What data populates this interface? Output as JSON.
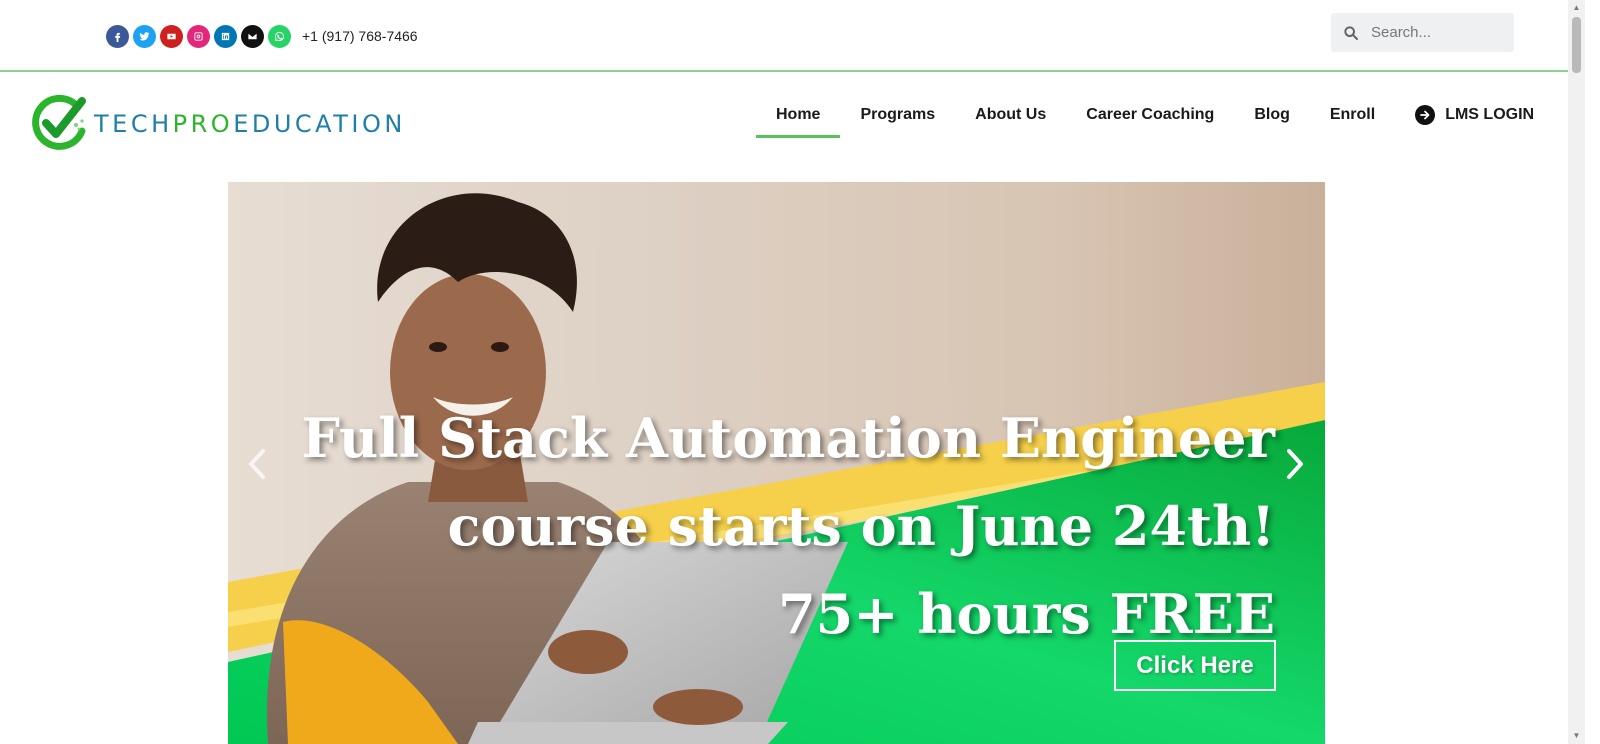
{
  "topbar": {
    "phone": "+1 (917) 768-7466",
    "socials": [
      {
        "icon": "facebook-icon",
        "color": "#3b5998"
      },
      {
        "icon": "twitter-icon",
        "color": "#1da1f2"
      },
      {
        "icon": "youtube-icon",
        "color": "#cd201f"
      },
      {
        "icon": "instagram-icon",
        "color": "#e4267a"
      },
      {
        "icon": "linkedin-icon",
        "color": "#0077b5"
      },
      {
        "icon": "envelope-icon",
        "color": "#111111"
      },
      {
        "icon": "whatsapp-icon",
        "color": "#25d366"
      }
    ],
    "search_placeholder": "Search..."
  },
  "logo": {
    "part1": "TECH",
    "part2": "PRO",
    "part3": "EDUCATION"
  },
  "nav": {
    "items": [
      "Home",
      "Programs",
      "About Us",
      "Career Coaching",
      "Blog",
      "Enroll"
    ],
    "active": "Home",
    "lms_label": "LMS LOGIN"
  },
  "hero": {
    "line1": "Full Stack Automation Engineer",
    "line2": "course starts on June 24th!",
    "line3": "75+ hours FREE",
    "cta": "Click Here"
  },
  "colors": {
    "accent_green": "#55c25a",
    "logo_blue": "#1f7fa8",
    "logo_green": "#2cb52c"
  }
}
